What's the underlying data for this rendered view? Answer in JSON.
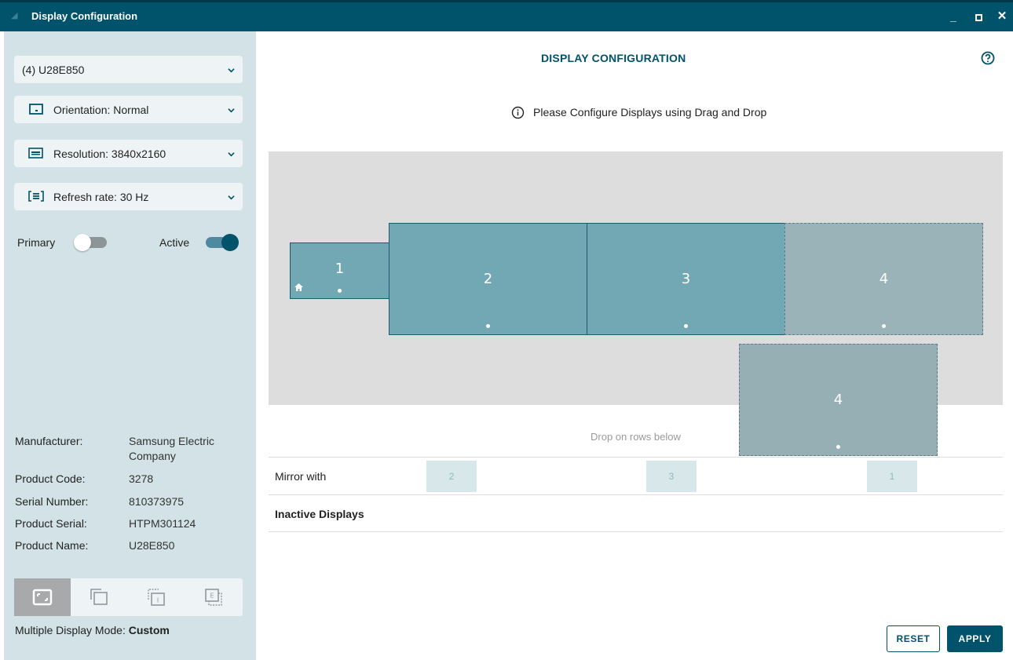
{
  "window": {
    "title": "Display Configuration",
    "controls": {
      "minimize": "_",
      "close": "✕"
    }
  },
  "sidebar": {
    "display_select": "(4) U28E850",
    "orientation": "Orientation: Normal",
    "resolution": "Resolution: 3840x2160",
    "refresh_rate": "Refresh rate: 30 Hz",
    "primary_label": "Primary",
    "primary_on": false,
    "active_label": "Active",
    "active_on": true,
    "info": [
      {
        "label": "Manufacturer:",
        "value": "Samsung Electric Company"
      },
      {
        "label": "Product Code:",
        "value": "3278"
      },
      {
        "label": "Serial Number:",
        "value": "810373975"
      },
      {
        "label": "Product Serial:",
        "value": "HTPM301124"
      },
      {
        "label": "Product Name:",
        "value": "U28E850"
      }
    ],
    "mode_label": "Multiple Display Mode:",
    "mode_value": "Custom",
    "mode_buttons": [
      "single",
      "mirror",
      "inactive",
      "extend"
    ],
    "mode_icon_letters": {
      "inactive": "I",
      "extend": "E"
    }
  },
  "main": {
    "title": "DISPLAY CONFIGURATION",
    "hint": "Please Configure Displays using Drag and Drop",
    "monitors": [
      {
        "id": "1",
        "primary": true
      },
      {
        "id": "2"
      },
      {
        "id": "3"
      },
      {
        "id": "4",
        "state": "placeholder"
      },
      {
        "id": "4",
        "state": "dragging"
      }
    ],
    "drop_hint": "Drop on rows below",
    "mirror_label": "Mirror with",
    "mirror_chips": [
      "2",
      "3",
      "1"
    ],
    "inactive_label": "Inactive Displays",
    "reset_label": "RESET",
    "apply_label": "APPLY"
  },
  "colors": {
    "accent": "#01526b",
    "sidebar_bg": "#d2e2e6",
    "monitor_fill": "#72a8b4",
    "monitor_ghost": "#9ab3b9"
  }
}
